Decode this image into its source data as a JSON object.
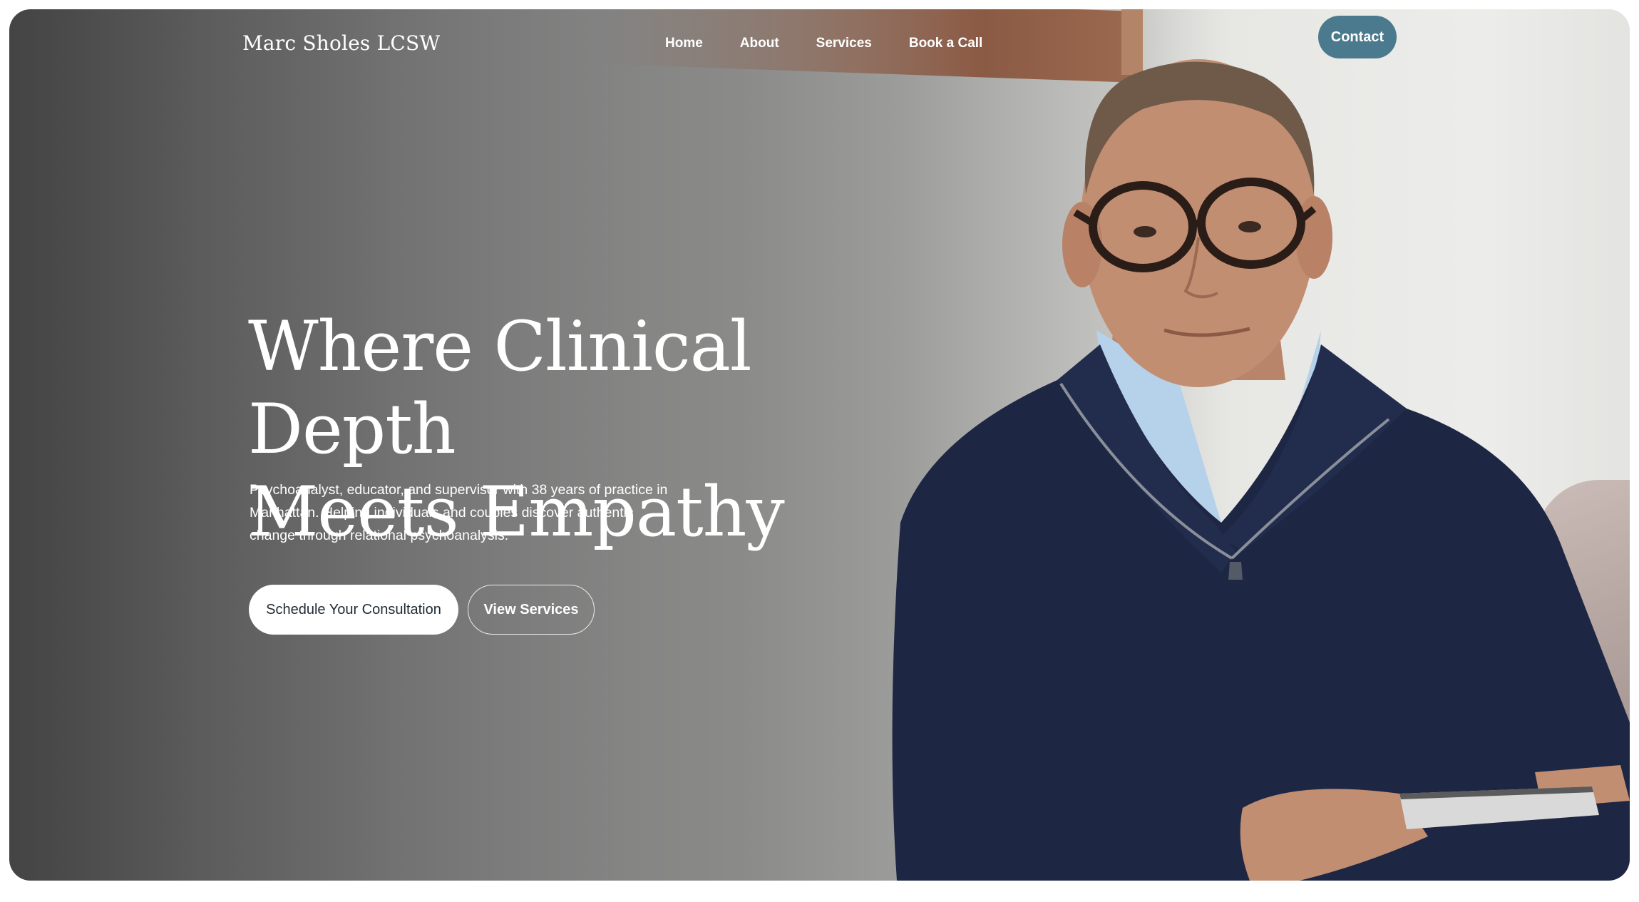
{
  "header": {
    "brand": "Marc Sholes LCSW",
    "nav": [
      {
        "label": "Home"
      },
      {
        "label": "About"
      },
      {
        "label": "Services"
      },
      {
        "label": "Book a Call"
      }
    ],
    "contact_label": "Contact"
  },
  "hero": {
    "title_line1": "Where Clinical Depth",
    "title_line2": "Meets Empathy",
    "subtitle_line1": "Psychoanalyst, educator, and supervisor with 38 years of practice in",
    "subtitle_line2": "Manhattan. Helping individuals and couples discover authentic",
    "subtitle_line3": "change through relational psychoanalysis.",
    "primary_cta": "Schedule Your Consultation",
    "secondary_cta": "View Services"
  },
  "colors": {
    "accent": "#4b7a8e",
    "sweater": "#1d2744",
    "shirt": "#b9d3ea"
  }
}
